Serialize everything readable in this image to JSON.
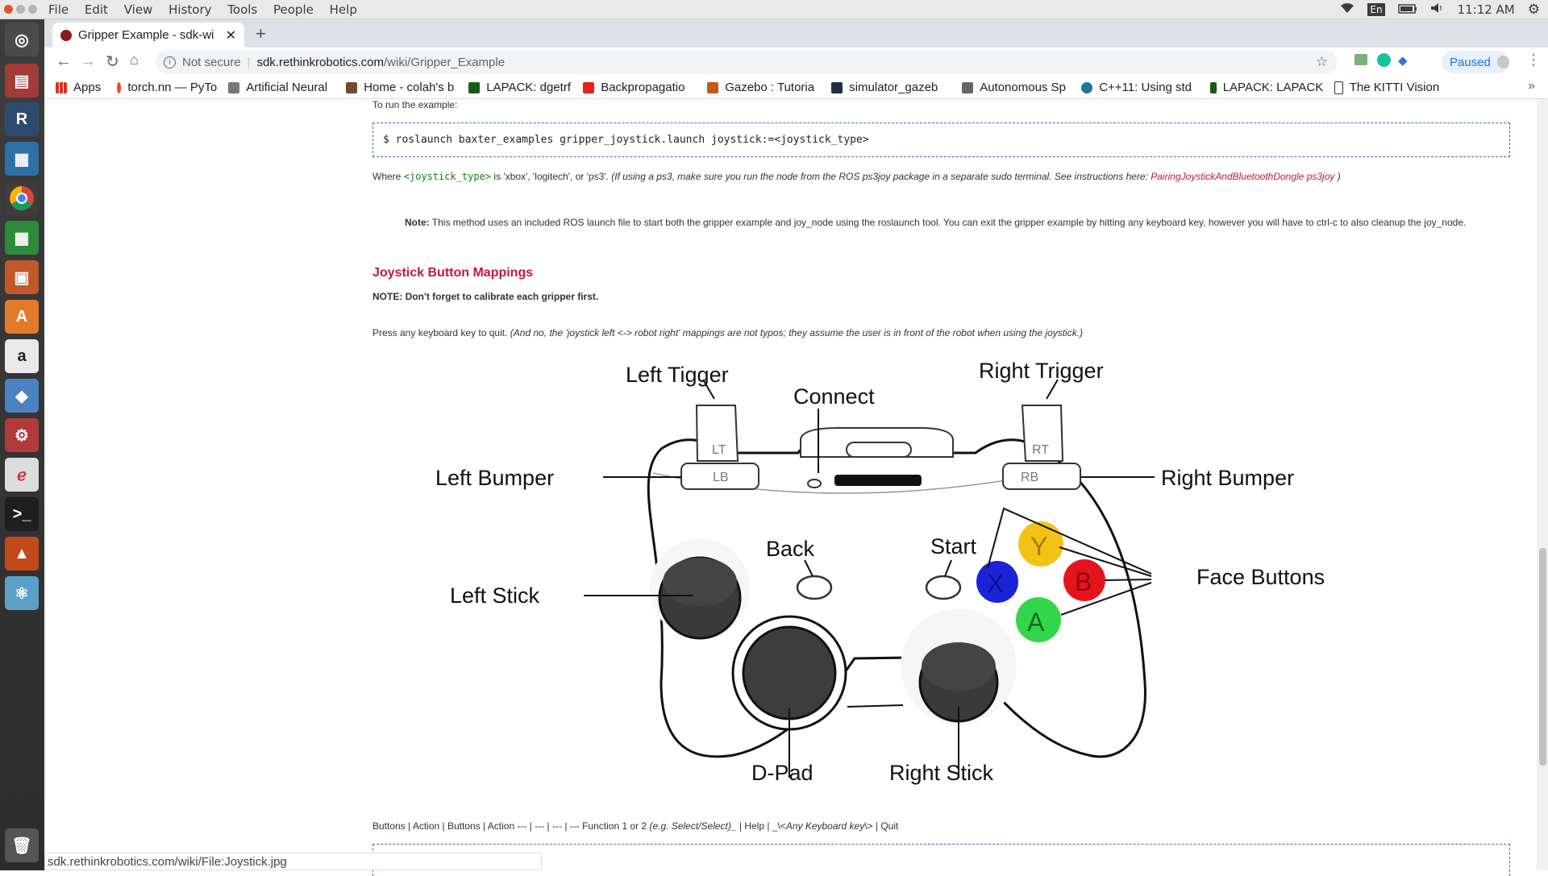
{
  "system": {
    "menu": [
      "File",
      "Edit",
      "View",
      "History",
      "Tools",
      "People",
      "Help"
    ],
    "language": "En",
    "clock": "11:12 AM"
  },
  "browser": {
    "tab_title": "Gripper Example - sdk-wi",
    "new_tab": "+",
    "security": "Not secure",
    "url_host": "sdk.rethinkrobotics.com",
    "url_path": "/wiki/Gripper_Example",
    "profile_status": "Paused",
    "bookmarks": [
      {
        "label": "Apps",
        "color": "#d93025"
      },
      {
        "label": "torch.nn — PyTo",
        "color": "#ee4c2c"
      },
      {
        "label": "Artificial Neural",
        "color": "#555555"
      },
      {
        "label": "Home - colah's b",
        "color": "#6b4e2e"
      },
      {
        "label": "LAPACK: dgetrf",
        "color": "#1c5a1c"
      },
      {
        "label": "Backpropagatio",
        "color": "#e62117"
      },
      {
        "label": "Gazebo : Tutoria",
        "color": "#c2581a"
      },
      {
        "label": "simulator_gazeb",
        "color": "#22313f"
      },
      {
        "label": "Autonomous Sp",
        "color": "#666666"
      },
      {
        "label": "C++11: Using std",
        "color": "#21759b"
      },
      {
        "label": "LAPACK: LAPACK",
        "color": "#1c5a1c"
      },
      {
        "label": "The KITTI Vision",
        "color": "#333333"
      }
    ],
    "more_bookmarks": "»",
    "status_url": "sdk.rethinkrobotics.com/wiki/File:Joystick.jpg"
  },
  "page": {
    "intro": "To run the example:",
    "command": "$ roslaunch baxter_examples gripper_joystick.launch joystick:=<joystick_type>",
    "where_prefix": "Where ",
    "where_code": "<joystick_type>",
    "where_mid": " is 'xbox', 'logitech', or 'ps3'. ",
    "where_italic": "(If using a ps3, make sure you run the node from the ROS ps3joy package in a separate sudo terminal. See instructions here: ",
    "where_link": "PairingJoystickAndBluetoothDongle ps3joy",
    "where_close": " )",
    "note_label": "Note:",
    "note_text": " This method uses an included ROS launch file to start both the gripper example and joy_node using the roslaunch tool. You can exit the gripper example by hitting any keyboard key, however you will have to ctrl-c to also cleanup the joy_node.",
    "heading": "Joystick Button Mappings",
    "calibrate": "NOTE: Don't forget to calibrate each gripper first.",
    "press_text": "Press any keyboard key to quit. ",
    "press_italic": "(And no, the 'joystick left <-> robot right' mappings are not typos; they assume the user is in front of the robot when using the joystick.)",
    "table_line_a": "Buttons | Action | Buttons | Action --- | --- | --- | --- Function 1 or 2 ",
    "table_line_b": "(e.g. Select/Select)_",
    "table_line_c": " | Help | _\\<",
    "table_line_d": "Any Keyboard key",
    "table_line_e": "\\> | Quit"
  },
  "figure": {
    "labels": {
      "left_trigger": "Left Tigger",
      "right_trigger": "Right Trigger",
      "connect": "Connect",
      "left_bumper": "Left Bumper",
      "right_bumper": "Right Bumper",
      "back": "Back",
      "start": "Start",
      "face_buttons": "Face Buttons",
      "left_stick": "Left Stick",
      "dpad": "D-Pad",
      "right_stick": "Right Stick"
    },
    "buttons": {
      "lt": "LT",
      "rt": "RT",
      "lb": "LB",
      "rb": "RB",
      "x": "X",
      "y": "Y",
      "a": "A",
      "b": "B"
    },
    "colors": {
      "x": "#1a23d6",
      "y": "#f2c316",
      "a": "#33d64a",
      "b": "#e3141c"
    }
  }
}
